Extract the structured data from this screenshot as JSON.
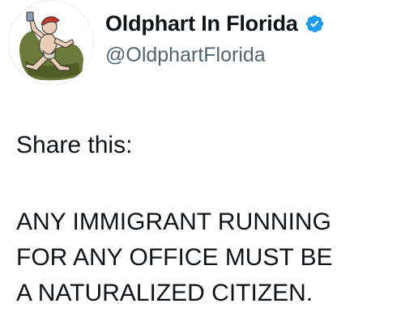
{
  "author": {
    "display_name": "Oldphart In Florida",
    "handle": "@OldphartFlorida",
    "verified": true,
    "verified_color": "#1d9bf0",
    "avatar_icon": "cartoon-old-man-avatar"
  },
  "tweet": {
    "lines": [
      "Share this:",
      "ANY IMMIGRANT RUNNING",
      "FOR ANY OFFICE MUST BE",
      "A NATURALIZED CITIZEN."
    ]
  }
}
